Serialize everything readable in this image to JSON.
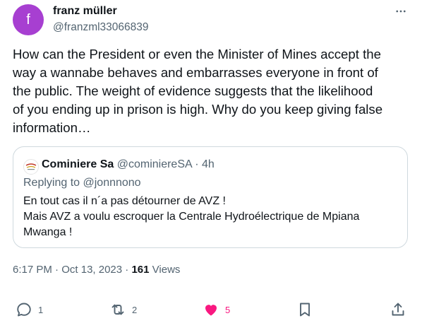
{
  "author": {
    "avatar_letter": "f",
    "avatar_color": "#a73fd1",
    "name": "franz müller",
    "handle": "@franzml33066839"
  },
  "tweet": {
    "text": "How can the President or even the Minister of Mines accept the\nway a wannabe behaves and embarrasses everyone in front of\nthe public. The weight of evidence suggests that the likelihood\nof you ending up in prison is high. Why do you keep giving false\ninformation…"
  },
  "quoted_tweet": {
    "name": "Cominiere Sa",
    "handle": "@cominiereSA",
    "separator": "·",
    "time": "4h",
    "replying_to": "Replying to @jonnnono",
    "text": "En tout cas il n´a pas détourner de AVZ !\nMais AVZ a voulu escroquer la Centrale Hydroélectrique  de Mpiana\nMwanga !"
  },
  "meta": {
    "time": "6:17 PM",
    "separator": "·",
    "date": "Oct 13, 2023",
    "views_count": "161",
    "views_label": "Views"
  },
  "actions": {
    "replies": "1",
    "reposts": "2",
    "likes": "5",
    "like_color": "#f91880",
    "icons": [
      "reply-icon",
      "repost-icon",
      "like-icon",
      "bookmark-icon",
      "share-icon"
    ]
  }
}
